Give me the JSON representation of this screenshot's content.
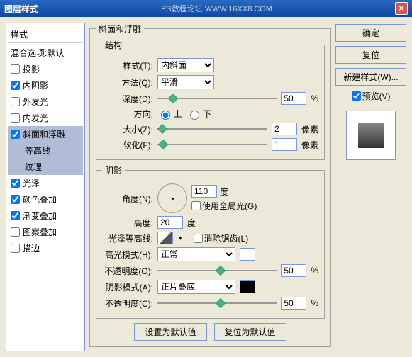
{
  "title": "图层样式",
  "watermark": "PS教程论坛  WWW.16XX8.COM",
  "sidebar": {
    "header": "样式",
    "blend_default": "混合选项:默认",
    "items": [
      {
        "label": "投影",
        "checked": false
      },
      {
        "label": "内阴影",
        "checked": true
      },
      {
        "label": "外发光",
        "checked": false
      },
      {
        "label": "内发光",
        "checked": false
      },
      {
        "label": "斜面和浮雕",
        "checked": true,
        "selected": true
      },
      {
        "label": "光泽",
        "checked": true
      },
      {
        "label": "颜色叠加",
        "checked": true
      },
      {
        "label": "渐变叠加",
        "checked": true
      },
      {
        "label": "图案叠加",
        "checked": false
      },
      {
        "label": "描边",
        "checked": false
      }
    ],
    "sub_contour": "等高线",
    "sub_texture": "纹理"
  },
  "bevel": {
    "title": "斜面和浮雕",
    "structure": {
      "legend": "结构",
      "style_label": "样式(T):",
      "style_value": "内斜面",
      "technique_label": "方法(Q):",
      "technique_value": "平滑",
      "depth_label": "深度(D):",
      "depth_value": "50",
      "depth_unit": "%",
      "direction_label": "方向:",
      "direction_up": "上",
      "direction_down": "下",
      "size_label": "大小(Z):",
      "size_value": "2",
      "size_unit": "像素",
      "soften_label": "软化(F):",
      "soften_value": "1",
      "soften_unit": "像素"
    },
    "shading": {
      "legend": "阴影",
      "angle_label": "角度(N):",
      "angle_value": "110",
      "angle_unit": "度",
      "global_light": "使用全局光(G)",
      "altitude_label": "高度:",
      "altitude_value": "20",
      "altitude_unit": "度",
      "gloss_label": "光泽等高线:",
      "antialias": "消除锯齿(L)",
      "highlight_mode_label": "高光模式(H):",
      "highlight_mode_value": "正常",
      "highlight_opacity_label": "不透明度(O):",
      "highlight_opacity_value": "50",
      "highlight_opacity_unit": "%",
      "shadow_mode_label": "阴影模式(A):",
      "shadow_mode_value": "正片叠底",
      "shadow_opacity_label": "不透明度(C):",
      "shadow_opacity_value": "50",
      "shadow_opacity_unit": "%"
    },
    "buttons": {
      "make_default": "设置为默认值",
      "reset_default": "复位为默认值"
    }
  },
  "actions": {
    "ok": "确定",
    "cancel": "复位",
    "new_style": "新建样式(W)...",
    "preview": "预览(V)"
  }
}
